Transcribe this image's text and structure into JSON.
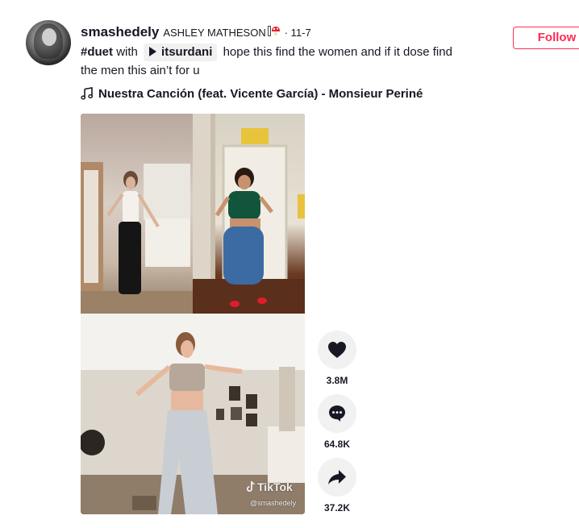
{
  "post": {
    "username": "smashedely",
    "nickname": "ASHLEY MATHESON",
    "nickname_suffix": "",
    "date": "· 11-7",
    "follow_label": "Follow",
    "caption": {
      "hashtag": "#duet",
      "with_text": "with",
      "mention": "itsurdani",
      "text": "hope this find the women and if it dose find the men this ain’t for u"
    },
    "music": "Nuestra Canción (feat. Vicente García) - Monsieur Periné"
  },
  "video": {
    "watermark": "TikTok",
    "watermark_user": "@smashedely"
  },
  "actions": {
    "likes": "3.8M",
    "comments": "64.8K",
    "shares": "37.2K"
  },
  "icons": {
    "like": "heart-icon",
    "comment": "comment-bubble-icon",
    "share": "share-arrow-icon",
    "music": "music-note-icon",
    "mention": "play-icon"
  },
  "colors": {
    "accent": "#fe2c55",
    "text": "#161823",
    "button_bg": "#f1f1f2"
  }
}
